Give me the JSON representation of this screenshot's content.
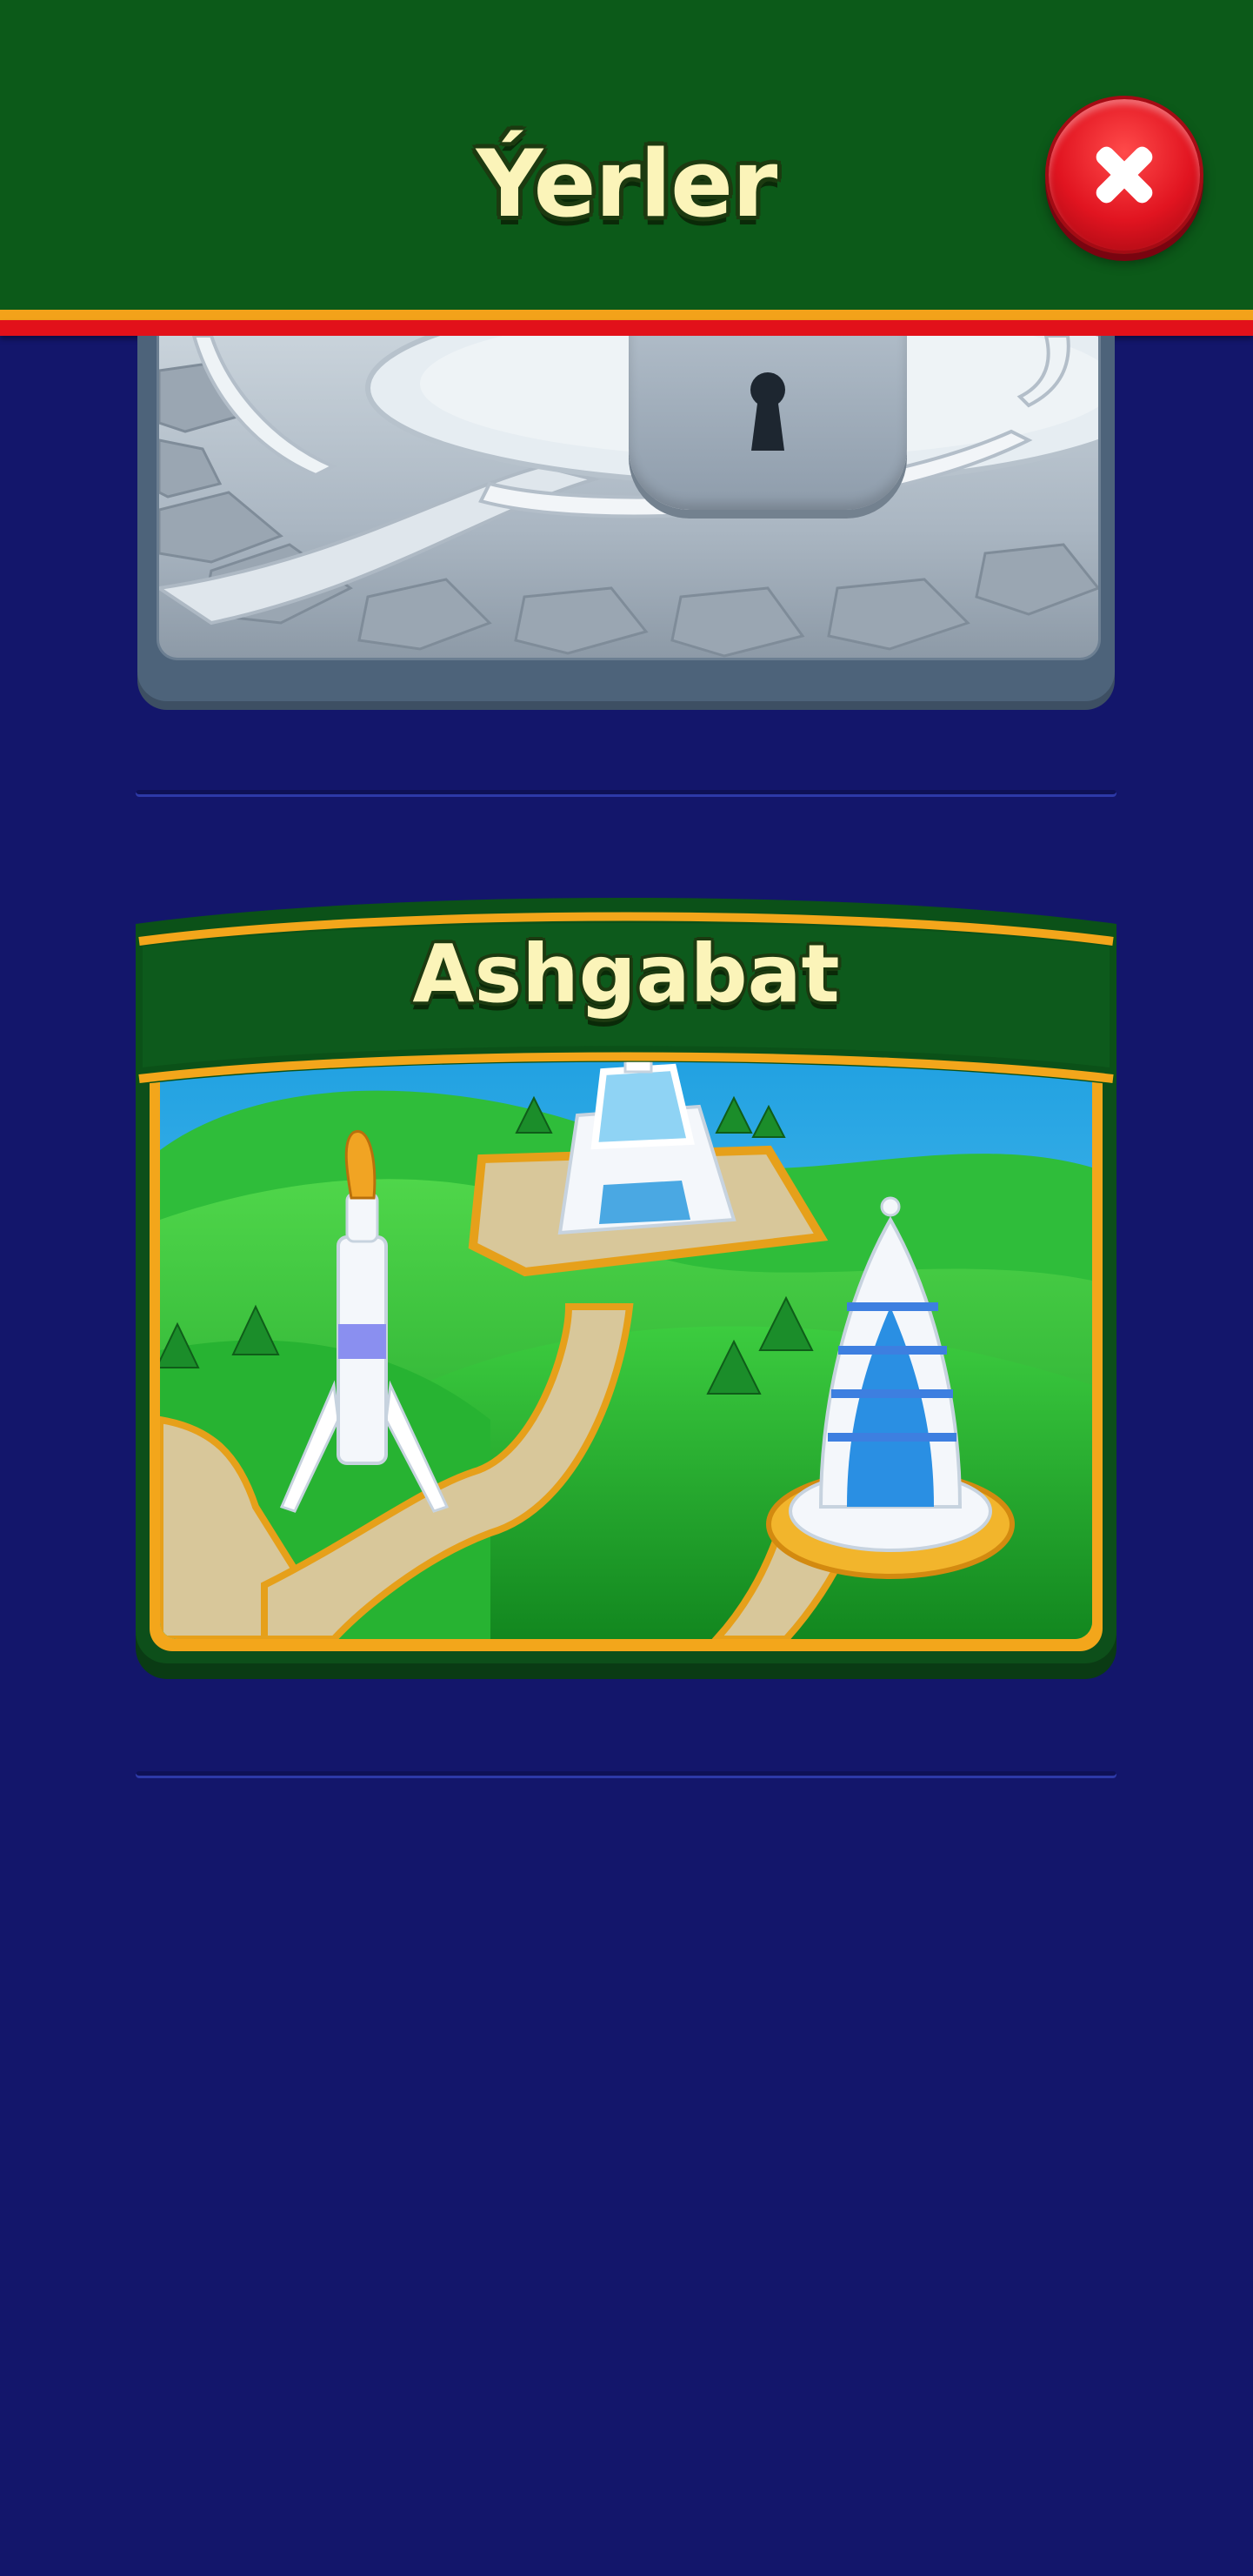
{
  "header": {
    "title": "Ýerler",
    "close_icon": "close-x-icon"
  },
  "locations": [
    {
      "name": "",
      "state": "locked",
      "icon": "lock-icon"
    },
    {
      "name": "Ashgabat",
      "state": "unlocked",
      "icon": "city-map-illustration"
    }
  ],
  "colors": {
    "background": "#13166b",
    "header": "#0c5a19",
    "accent_orange": "#f3a21a",
    "accent_red": "#e2111a",
    "title_text": "#fbf4b9",
    "close_button": "#e11420"
  }
}
